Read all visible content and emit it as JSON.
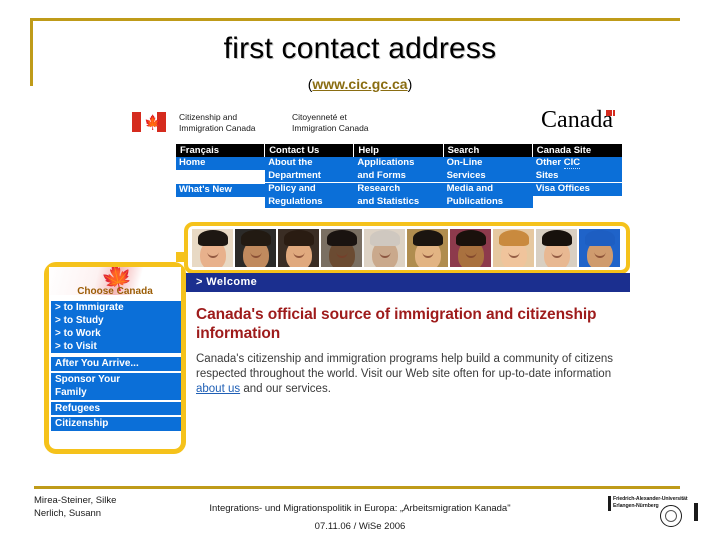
{
  "slide": {
    "title": "first contact address",
    "url_open": "(",
    "url": "www.cic.gc.ca",
    "url_close": ")"
  },
  "site_header": {
    "flag_icon": "canada-flag-icon",
    "dept_en_line1": "Citizenship and",
    "dept_en_line2": "Immigration Canada",
    "dept_fr_line1": "Citoyenneté et",
    "dept_fr_line2": "Immigration Canada",
    "wordmark": "Canada"
  },
  "top_nav": [
    "Français",
    "Contact Us",
    "Help",
    "Search",
    "Canada Site"
  ],
  "nav_columns": [
    {
      "items": [
        "Home",
        "What's New"
      ]
    },
    {
      "items": [
        "About the\nDepartment",
        "Policy and\nRegulations"
      ]
    },
    {
      "items": [
        "Applications\nand Forms",
        "Research\nand Statistics"
      ]
    },
    {
      "items": [
        "On-Line\nServices",
        "Media and\nPublications"
      ]
    },
    {
      "items": [
        "Other CIC\nSites",
        "Visa Offices"
      ]
    }
  ],
  "banner": {
    "welcome_label": "> Welcome",
    "faces": [
      {
        "name": "face-photo-1",
        "bg": "#e8d9c4",
        "skin": "#e8b18c",
        "hair": "#1d1712"
      },
      {
        "name": "face-photo-2",
        "bg": "#2b2a28",
        "skin": "#c08a5e",
        "hair": "#221a12"
      },
      {
        "name": "face-photo-3",
        "bg": "#3a2d24",
        "skin": "#e0a97e",
        "hair": "#2a1c12"
      },
      {
        "name": "face-photo-4",
        "bg": "#7a6f62",
        "skin": "#6b4b32",
        "hair": "#1a1310"
      },
      {
        "name": "face-photo-5",
        "bg": "#ddd2c4",
        "skin": "#caa98c",
        "hair": "#cfc8c0"
      },
      {
        "name": "face-photo-6",
        "bg": "#b08d4f",
        "skin": "#e2b483",
        "hair": "#1b1510"
      },
      {
        "name": "face-photo-7",
        "bg": "#8d3a4c",
        "skin": "#a9713f",
        "hair": "#1a110c"
      },
      {
        "name": "face-photo-8",
        "bg": "#e6c8a0",
        "skin": "#f0c49c",
        "hair": "#c98a3e"
      },
      {
        "name": "face-photo-9",
        "bg": "#d8cfc2",
        "skin": "#e8b892",
        "hair": "#17110c"
      },
      {
        "name": "face-photo-10",
        "bg": "#1f63c9",
        "skin": "#cf9b6e",
        "hair": "#1d5ec2"
      }
    ]
  },
  "sidebar": {
    "heading": "Choose Canada",
    "choose_items": [
      "> to Immigrate",
      "> to Study",
      "> to Work",
      "> to Visit"
    ],
    "items": [
      "After You Arrive...",
      "Sponsor Your\nFamily",
      "Refugees",
      "Citizenship"
    ]
  },
  "main": {
    "heading": "Canada's official source of immigration and citizenship information",
    "body_part1": "Canada's citizenship and immigration programs help build a community of citizens respected throughout the world. Visit our Web site often for up-to-date information ",
    "body_link": "about us",
    "body_part2": " and our services."
  },
  "footer": {
    "author_line1": "Mirea-Steiner, Silke",
    "author_line2": "Nerlich, Susann",
    "subject": "Integrations- und Migrationspolitik in Europa: „Arbeitsmigration Kanada\"",
    "date": "07.11.06 / WiSe 2006",
    "university_line1": "Friedrich-Alexander-Universität",
    "university_line2": "Erlangen-Nürnberg"
  },
  "colors": {
    "gold": "#bf9b19",
    "banner_yellow": "#f5c21b",
    "nav_blue": "#0b6fd8",
    "welcome_blue": "#1b2f8f",
    "heading_red": "#9e1b1b",
    "flag_red": "#d52b1e"
  }
}
